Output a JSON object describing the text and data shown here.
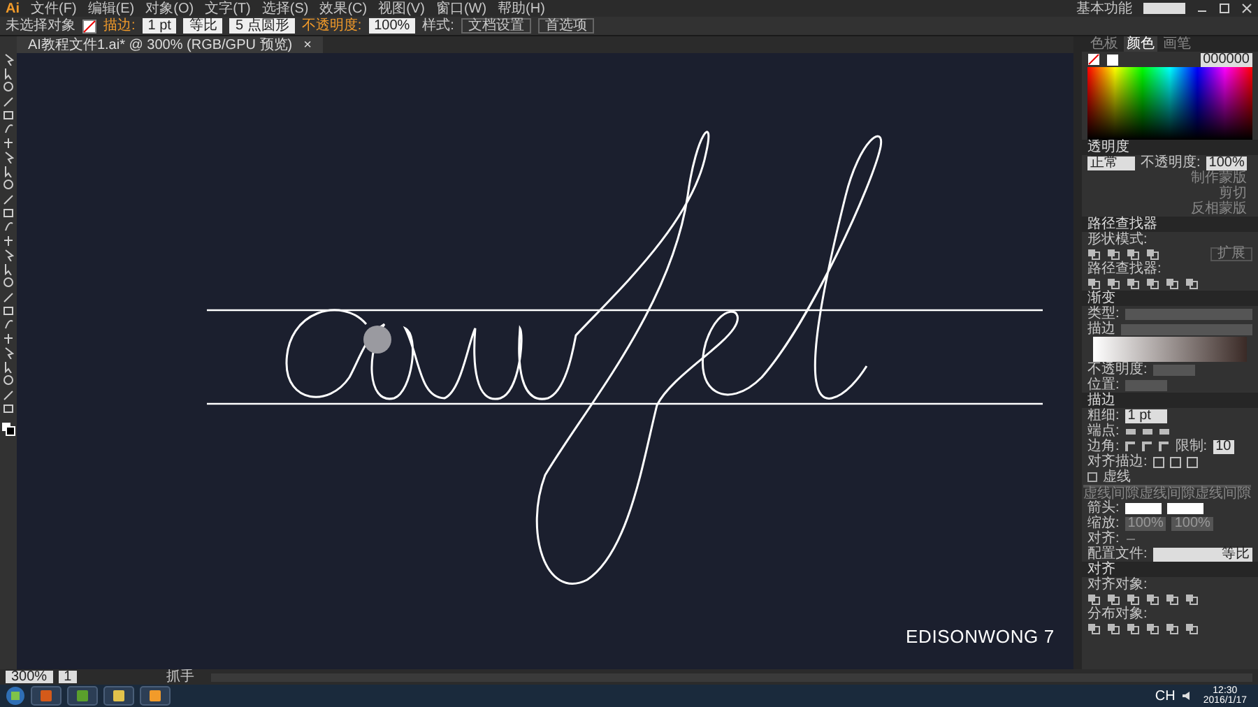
{
  "menu_bar": {
    "logo": "Ai",
    "items": [
      "文件(F)",
      "编辑(E)",
      "对象(O)",
      "文字(T)",
      "选择(S)",
      "效果(C)",
      "视图(V)",
      "窗口(W)",
      "帮助(H)"
    ],
    "workspace": "基本功能"
  },
  "control_bar": [
    {
      "kind": "label",
      "text": "未选择对象",
      "accent": false
    },
    {
      "kind": "swatch"
    },
    {
      "kind": "label",
      "text": "描边:",
      "accent": true
    },
    {
      "kind": "field",
      "text": "1 pt"
    },
    {
      "kind": "field",
      "text": "等比"
    },
    {
      "kind": "field",
      "text": "5 点圆形"
    },
    {
      "kind": "label",
      "text": "不透明度:",
      "accent": true
    },
    {
      "kind": "field",
      "text": "100%"
    },
    {
      "kind": "label",
      "text": "样式:",
      "accent": false
    },
    {
      "kind": "button",
      "text": "文档设置"
    },
    {
      "kind": "button",
      "text": "首选项"
    }
  ],
  "document_tab": {
    "title": "AI教程文件1.ai* @ 300% (RGB/GPU 预览)",
    "close": "×"
  },
  "canvas": {
    "signature": "EDISONWONG 7"
  },
  "color_panel": {
    "tabs": [
      {
        "label": "色板",
        "selected": false
      },
      {
        "label": "颜色",
        "selected": true
      },
      {
        "label": "画笔",
        "selected": false
      }
    ],
    "hex": "000000"
  },
  "transparency_panel": {
    "title": "透明度",
    "blend_mode": "正常",
    "opacity_label": "不透明度:",
    "opacity": "100%",
    "buttons": [
      "制作蒙版",
      "剪切",
      "反相蒙版"
    ]
  },
  "pathfinder_panel": {
    "title": "路径查找器",
    "shape_modes_label": "形状模式:",
    "expand": "扩展",
    "pathfinders_label": "路径查找器:"
  },
  "gradient_panel": {
    "title": "渐变",
    "type_label": "类型:",
    "stroke_label": "描边",
    "opacity_label": "不透明度:",
    "location_label": "位置:"
  },
  "stroke_panel": {
    "title": "描边",
    "weight_label": "粗细:",
    "weight": "1 pt",
    "cap_label": "端点:",
    "corner_label": "边角:",
    "limit_label": "限制:",
    "limit": "10",
    "align_label": "对齐描边:",
    "dashed": {
      "label": "虚线",
      "checked": false
    },
    "dash_cells": [
      "虚线",
      "间隙",
      "虚线",
      "间隙",
      "虚线",
      "间隙"
    ],
    "arrowheads_label": "箭头:",
    "scale_label": "缩放:",
    "scale": [
      "100%",
      "100%"
    ],
    "align_arrows_label": "对齐:",
    "profile_label": "配置文件:",
    "profile": "等比"
  },
  "align_panel": {
    "title": "对齐",
    "align_objects_label": "对齐对象:",
    "distribute_objects_label": "分布对象:"
  },
  "status_bar": {
    "zoom": "300%",
    "artboard": "1",
    "tool": "抓手"
  },
  "taskbar": {
    "language": "CH",
    "time": "12:30",
    "date": "2016/1/17"
  }
}
